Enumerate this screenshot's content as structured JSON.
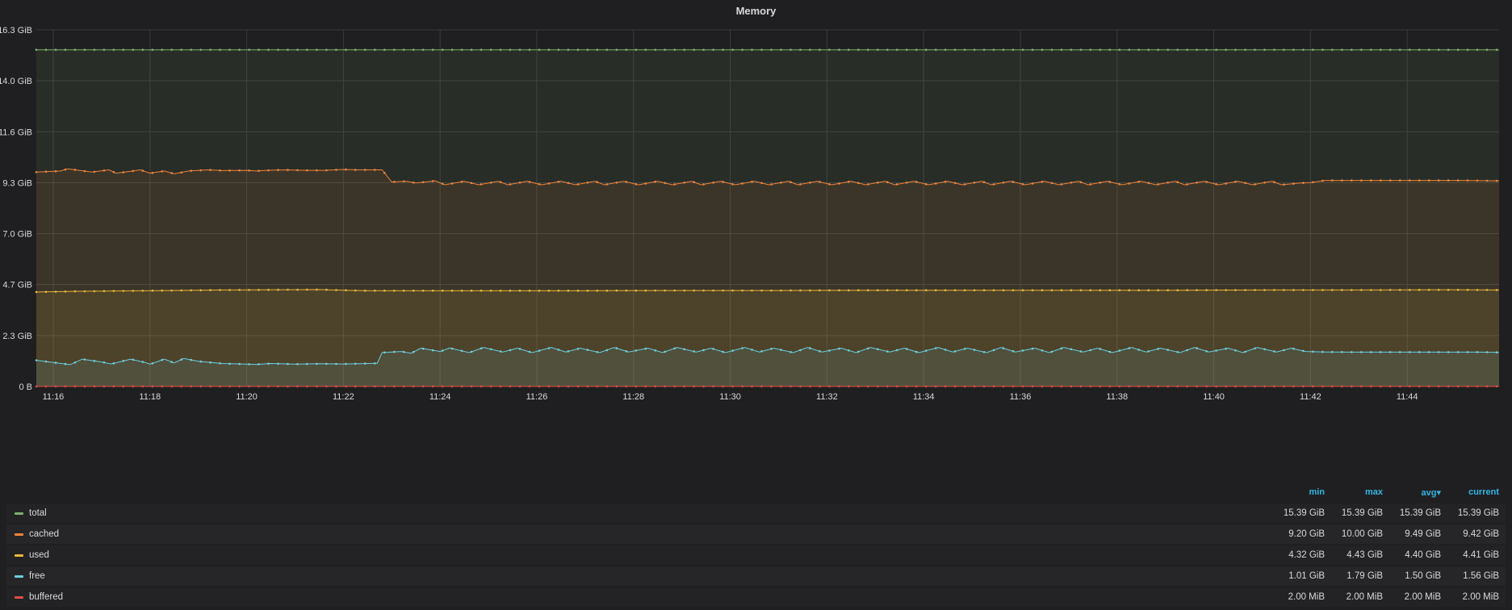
{
  "panel": {
    "title": "Memory"
  },
  "chart_data": {
    "type": "area",
    "title": "Memory",
    "ylabel": "",
    "xlabel": "",
    "ylim": [
      0,
      16.3
    ],
    "y_ticks": [
      {
        "value": 0,
        "label": "0 B"
      },
      {
        "value": 2.33,
        "label": "2.3 GiB"
      },
      {
        "value": 4.66,
        "label": "4.7 GiB"
      },
      {
        "value": 6.99,
        "label": "7.0 GiB"
      },
      {
        "value": 9.31,
        "label": "9.3 GiB"
      },
      {
        "value": 11.64,
        "label": "11.6 GiB"
      },
      {
        "value": 13.97,
        "label": "14.0 GiB"
      },
      {
        "value": 16.3,
        "label": "16.3 GiB"
      }
    ],
    "x_range_minutes": [
      15.65,
      45.9
    ],
    "x_ticks": [
      {
        "minute": 16,
        "label": "11:16"
      },
      {
        "minute": 18,
        "label": "11:18"
      },
      {
        "minute": 20,
        "label": "11:20"
      },
      {
        "minute": 22,
        "label": "11:22"
      },
      {
        "minute": 24,
        "label": "11:24"
      },
      {
        "minute": 26,
        "label": "11:26"
      },
      {
        "minute": 28,
        "label": "11:28"
      },
      {
        "minute": 30,
        "label": "11:30"
      },
      {
        "minute": 32,
        "label": "11:32"
      },
      {
        "minute": 34,
        "label": "11:34"
      },
      {
        "minute": 36,
        "label": "11:36"
      },
      {
        "minute": 38,
        "label": "11:38"
      },
      {
        "minute": 40,
        "label": "11:40"
      },
      {
        "minute": 42,
        "label": "11:42"
      },
      {
        "minute": 44,
        "label": "11:44"
      }
    ],
    "grid": true,
    "series": [
      {
        "name": "total",
        "color": "#7eb26d",
        "x_minutes": [
          15.65,
          45.9
        ],
        "values": [
          15.39,
          15.39
        ]
      },
      {
        "name": "cached",
        "color": "#ef843c",
        "x_minutes": [
          15.65,
          16.15,
          16.3,
          16.8,
          17.15,
          17.3,
          17.65,
          17.8,
          18.0,
          18.3,
          18.5,
          18.8,
          19.2,
          19.5,
          20.0,
          20.2,
          20.4,
          20.8,
          21.2,
          21.6,
          22.0,
          22.3,
          22.6,
          22.8,
          23.0,
          23.3,
          23.5,
          23.9,
          24.1,
          24.5,
          24.8,
          25.2,
          25.4,
          25.8,
          26.1,
          26.5,
          26.8,
          27.2,
          27.4,
          27.8,
          28.1,
          28.5,
          28.8,
          29.2,
          29.4,
          29.8,
          30.1,
          30.5,
          30.8,
          31.2,
          31.4,
          31.8,
          32.1,
          32.5,
          32.8,
          33.2,
          33.4,
          33.8,
          34.1,
          34.5,
          34.8,
          35.2,
          35.4,
          35.8,
          36.1,
          36.5,
          36.8,
          37.2,
          37.4,
          37.8,
          38.1,
          38.5,
          38.8,
          39.2,
          39.4,
          39.8,
          40.1,
          40.5,
          40.8,
          41.2,
          41.4,
          41.8,
          42.0,
          42.3,
          45.2,
          45.9
        ],
        "values": [
          9.8,
          9.85,
          9.95,
          9.8,
          9.9,
          9.75,
          9.85,
          9.9,
          9.75,
          9.85,
          9.72,
          9.85,
          9.9,
          9.87,
          9.88,
          9.85,
          9.88,
          9.9,
          9.88,
          9.88,
          9.92,
          9.9,
          9.9,
          9.9,
          9.35,
          9.38,
          9.3,
          9.4,
          9.22,
          9.38,
          9.22,
          9.38,
          9.22,
          9.38,
          9.22,
          9.38,
          9.22,
          9.38,
          9.22,
          9.38,
          9.22,
          9.38,
          9.22,
          9.38,
          9.22,
          9.38,
          9.22,
          9.38,
          9.22,
          9.38,
          9.22,
          9.38,
          9.22,
          9.38,
          9.22,
          9.38,
          9.22,
          9.38,
          9.22,
          9.38,
          9.22,
          9.38,
          9.22,
          9.38,
          9.22,
          9.38,
          9.22,
          9.38,
          9.22,
          9.38,
          9.22,
          9.38,
          9.22,
          9.38,
          9.22,
          9.38,
          9.22,
          9.38,
          9.22,
          9.38,
          9.22,
          9.3,
          9.32,
          9.42,
          9.42,
          9.4
        ]
      },
      {
        "name": "used",
        "color": "#eab839",
        "x_minutes": [
          15.65,
          16.5,
          17.5,
          18.5,
          19.5,
          20.5,
          21.5,
          22.0,
          22.5,
          23.5,
          25,
          27,
          29,
          31,
          33,
          35,
          37,
          39,
          41,
          43,
          45,
          45.9
        ],
        "values": [
          4.32,
          4.35,
          4.37,
          4.39,
          4.41,
          4.42,
          4.43,
          4.4,
          4.38,
          4.38,
          4.38,
          4.38,
          4.39,
          4.39,
          4.4,
          4.4,
          4.4,
          4.4,
          4.41,
          4.41,
          4.42,
          4.41
        ]
      },
      {
        "name": "free",
        "color": "#6ed0e0",
        "x_minutes": [
          15.65,
          16.0,
          16.35,
          16.6,
          17.0,
          17.2,
          17.6,
          17.9,
          18.0,
          18.3,
          18.5,
          18.7,
          19.0,
          19.5,
          20.0,
          20.2,
          20.5,
          21.0,
          21.5,
          22.0,
          22.5,
          22.7,
          22.8,
          23.2,
          23.4,
          23.6,
          24.0,
          24.2,
          24.6,
          24.9,
          25.3,
          25.6,
          25.9,
          26.3,
          26.6,
          26.9,
          27.3,
          27.6,
          27.9,
          28.3,
          28.6,
          28.9,
          29.3,
          29.6,
          29.9,
          30.3,
          30.6,
          30.9,
          31.3,
          31.6,
          31.9,
          32.3,
          32.6,
          32.9,
          33.3,
          33.6,
          33.9,
          34.3,
          34.6,
          34.9,
          35.3,
          35.6,
          35.9,
          36.3,
          36.6,
          36.9,
          37.3,
          37.6,
          37.9,
          38.3,
          38.6,
          38.9,
          39.3,
          39.6,
          39.9,
          40.3,
          40.6,
          40.9,
          41.3,
          41.6,
          41.9,
          42.3,
          42.8,
          45.5,
          45.9
        ],
        "values": [
          1.2,
          1.1,
          1.0,
          1.25,
          1.12,
          1.03,
          1.25,
          1.1,
          1.02,
          1.25,
          1.08,
          1.28,
          1.15,
          1.05,
          1.02,
          1.01,
          1.05,
          1.02,
          1.04,
          1.03,
          1.05,
          1.06,
          1.55,
          1.6,
          1.52,
          1.75,
          1.6,
          1.76,
          1.55,
          1.78,
          1.58,
          1.75,
          1.55,
          1.78,
          1.58,
          1.75,
          1.55,
          1.78,
          1.58,
          1.75,
          1.55,
          1.78,
          1.58,
          1.75,
          1.55,
          1.78,
          1.58,
          1.75,
          1.55,
          1.78,
          1.58,
          1.75,
          1.55,
          1.78,
          1.58,
          1.75,
          1.55,
          1.78,
          1.58,
          1.75,
          1.55,
          1.78,
          1.58,
          1.75,
          1.55,
          1.78,
          1.58,
          1.75,
          1.55,
          1.78,
          1.58,
          1.75,
          1.55,
          1.78,
          1.58,
          1.75,
          1.55,
          1.78,
          1.58,
          1.75,
          1.6,
          1.58,
          1.57,
          1.57,
          1.56
        ]
      },
      {
        "name": "buffered",
        "color": "#e24d42",
        "x_minutes": [
          15.65,
          45.9
        ],
        "values": [
          0.002,
          0.002
        ]
      }
    ]
  },
  "legend": {
    "headers": {
      "min": "min",
      "max": "max",
      "avg": "avg",
      "avg_sort": "▾",
      "current": "current"
    },
    "rows": [
      {
        "name": "total",
        "color": "#7eb26d",
        "min": "15.39 GiB",
        "max": "15.39 GiB",
        "avg": "15.39 GiB",
        "current": "15.39 GiB"
      },
      {
        "name": "cached",
        "color": "#ef843c",
        "min": "9.20 GiB",
        "max": "10.00 GiB",
        "avg": "9.49 GiB",
        "current": "9.42 GiB"
      },
      {
        "name": "used",
        "color": "#eab839",
        "min": "4.32 GiB",
        "max": "4.43 GiB",
        "avg": "4.40 GiB",
        "current": "4.41 GiB"
      },
      {
        "name": "free",
        "color": "#6ed0e0",
        "min": "1.01 GiB",
        "max": "1.79 GiB",
        "avg": "1.50 GiB",
        "current": "1.56 GiB"
      },
      {
        "name": "buffered",
        "color": "#e24d42",
        "min": "2.00 MiB",
        "max": "2.00 MiB",
        "avg": "2.00 MiB",
        "current": "2.00 MiB"
      }
    ]
  }
}
